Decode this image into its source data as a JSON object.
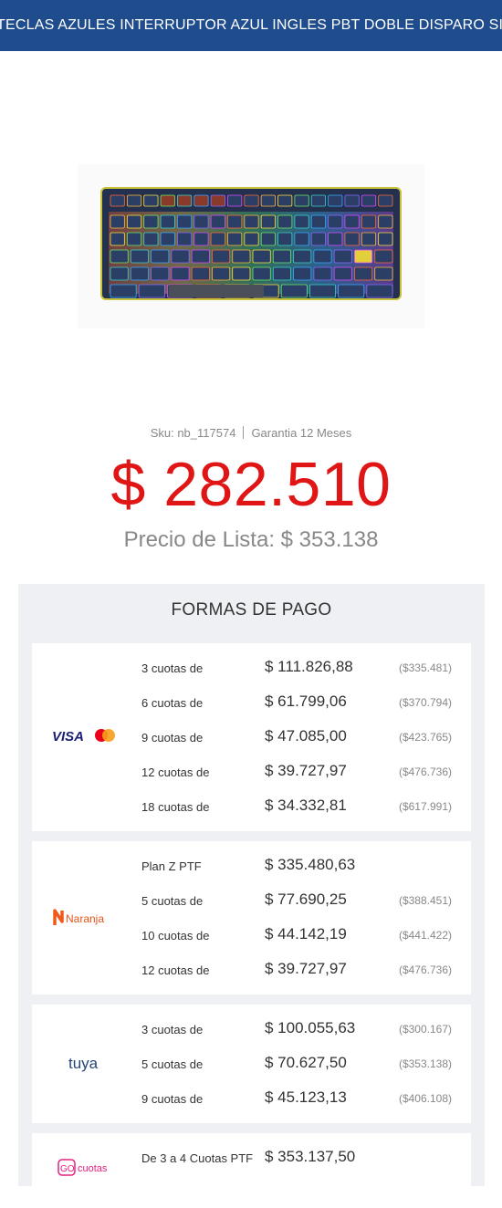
{
  "product": {
    "title": "TECLAS AZULES INTERRUPTOR AZUL INGLES PBT DOBLE DISPARO SIN COSTO",
    "image_alt": "keyboard-image",
    "sku_text": "Sku: nb_117574",
    "warranty_text": "Garantia 12 Meses",
    "price": "$ 282.510",
    "list_price": "Precio de Lista: $ 353.138"
  },
  "payments": {
    "title": "FORMAS DE PAGO",
    "methods": [
      {
        "logo": "visa-mastercard-logo",
        "rows": [
          {
            "label": "3 cuotas de",
            "amount": "$ 111.826,88",
            "total": "($335.481)"
          },
          {
            "label": "6 cuotas de",
            "amount": "$ 61.799,06",
            "total": "($370.794)"
          },
          {
            "label": "9 cuotas de",
            "amount": "$ 47.085,00",
            "total": "($423.765)"
          },
          {
            "label": "12 cuotas de",
            "amount": "$ 39.727,97",
            "total": "($476.736)"
          },
          {
            "label": "18 cuotas de",
            "amount": "$ 34.332,81",
            "total": "($617.991)"
          }
        ]
      },
      {
        "logo": "naranja-logo",
        "logo_text": "Naranja",
        "rows": [
          {
            "label": "Plan Z PTF",
            "amount": "$ 335.480,63",
            "total": ""
          },
          {
            "label": "5 cuotas de",
            "amount": "$ 77.690,25",
            "total": "($388.451)"
          },
          {
            "label": "10 cuotas de",
            "amount": "$ 44.142,19",
            "total": "($441.422)"
          },
          {
            "label": "12 cuotas de",
            "amount": "$ 39.727,97",
            "total": "($476.736)"
          }
        ]
      },
      {
        "logo": "tuya-logo",
        "logo_text": "tuya",
        "rows": [
          {
            "label": "3 cuotas de",
            "amount": "$ 100.055,63",
            "total": "($300.167)"
          },
          {
            "label": "5 cuotas de",
            "amount": "$ 70.627,50",
            "total": "($353.138)"
          },
          {
            "label": "9 cuotas de",
            "amount": "$ 45.123,13",
            "total": "($406.108)"
          }
        ]
      },
      {
        "logo": "gocuotas-logo",
        "logo_text": "cuotas",
        "logo_prefix": "GO",
        "rows": [
          {
            "label": "De 3 a 4 Cuotas PTF",
            "amount": "$ 353.137,50",
            "total": ""
          }
        ]
      }
    ]
  },
  "colors": {
    "header_bg": "#1f4c8c",
    "price_red": "#e01515",
    "panel_bg": "#eef0f3"
  }
}
